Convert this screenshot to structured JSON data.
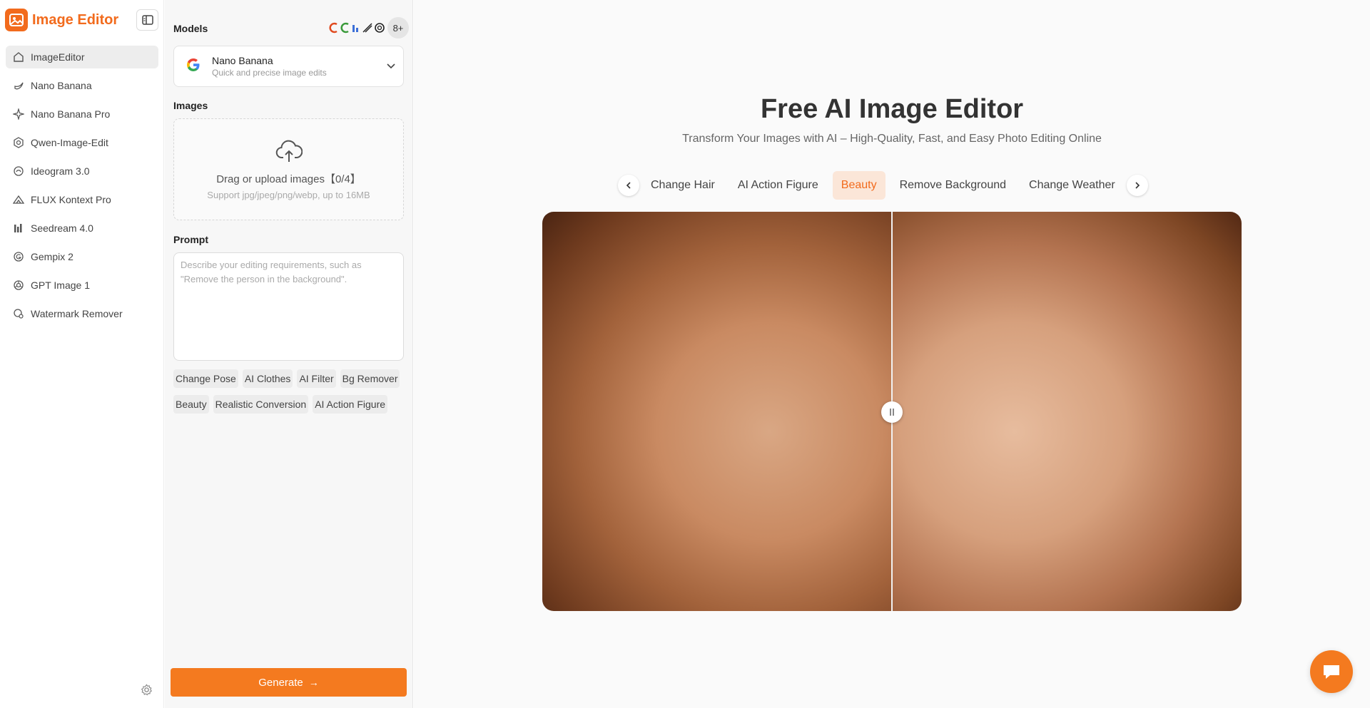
{
  "app": {
    "title": "Image Editor"
  },
  "nav": {
    "items": [
      {
        "label": "ImageEditor",
        "icon": "home-icon",
        "active": true
      },
      {
        "label": "Nano Banana",
        "icon": "banana-icon"
      },
      {
        "label": "Nano Banana Pro",
        "icon": "sparkle-icon"
      },
      {
        "label": "Qwen-Image-Edit",
        "icon": "qwen-icon"
      },
      {
        "label": "Ideogram 3.0",
        "icon": "ideogram-icon"
      },
      {
        "label": "FLUX Kontext Pro",
        "icon": "flux-icon"
      },
      {
        "label": "Seedream 4.0",
        "icon": "bars-icon"
      },
      {
        "label": "Gempix 2",
        "icon": "gempix-icon"
      },
      {
        "label": "GPT Image 1",
        "icon": "openai-icon"
      },
      {
        "label": "Watermark Remover",
        "icon": "watermark-icon"
      }
    ]
  },
  "panel": {
    "models_label": "Models",
    "models_more": "8+",
    "model": {
      "name": "Nano Banana",
      "desc": "Quick and precise image edits",
      "icon": "google-icon"
    },
    "images_label": "Images",
    "upload_text": "Drag or upload images【0/4】",
    "upload_hint": "Support jpg/jpeg/png/webp, up to 16MB",
    "prompt_label": "Prompt",
    "prompt_placeholder": "Describe your editing requirements, such as \"Remove the person in the background\".",
    "chips": [
      "Change Pose",
      "AI Clothes",
      "AI Filter",
      "Bg Remover",
      "Beauty",
      "Realistic Conversion",
      "AI Action Figure"
    ],
    "generate_label": "Generate"
  },
  "main": {
    "title": "Free AI Image Editor",
    "subtitle": "Transform Your Images with AI – High-Quality, Fast, and Easy Photo Editing Online",
    "tabs": [
      "Change Hair",
      "AI Action Figure",
      "Beauty",
      "Remove Background",
      "Change Weather"
    ],
    "active_tab": "Beauty"
  },
  "colors": {
    "accent": "#f26b1d",
    "button": "#f47a1f",
    "active_tab_bg": "#fbe6d8"
  }
}
